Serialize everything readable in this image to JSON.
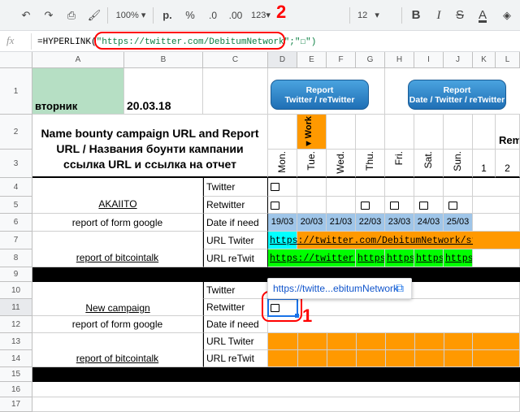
{
  "toolbar": {
    "zoom": "100%",
    "currency": "р.",
    "percent": "%",
    "dec_minus": ".0",
    "dec_plus": ".00",
    "format_more": "123",
    "font_size": "12",
    "bold": "B",
    "italic": "I",
    "strike": "S",
    "text_color": "A",
    "annotation": "2"
  },
  "formula_bar": {
    "fx": "fx",
    "prefix": "=HYPERLINK(",
    "url_arg": "\"https://twitter.com/DebitumNetwork\"",
    "suffix_arg": ";\"☐\")"
  },
  "columns": [
    "A",
    "B",
    "C",
    "D",
    "E",
    "F",
    "G",
    "H",
    "I",
    "J",
    "K",
    "L"
  ],
  "rows": [
    "1",
    "2",
    "3",
    "4",
    "5",
    "6",
    "7",
    "8",
    "9",
    "10",
    "11",
    "12",
    "13",
    "14",
    "15",
    "16",
    "17"
  ],
  "header": {
    "weekday": "вторник",
    "date": "20.03.18",
    "title": "Name bounty campaign URL and Report URL / Названия боунти кампании ссылка URL и ссылка на отчет",
    "btn_report1": "Report\nTwitter / reTwitter",
    "btn_report2": "Report\nDate / Twitter / reTwitter",
    "work": "◄Work",
    "days": [
      "Mon.",
      "Tue.",
      "Wed.",
      "Thu.",
      "Fri.",
      "Sat.",
      "Sun."
    ],
    "nums": [
      "1",
      "2"
    ],
    "rem": "Rem"
  },
  "campaign1": {
    "name": "AKAIITO",
    "report_form": "report of form google",
    "report_talk": "report of bitcointalk",
    "labels": [
      "Twitter",
      "Retwitter",
      "Date if need",
      "URL Twiter",
      "URL reTwit"
    ],
    "dates": [
      "19/03",
      "20/03",
      "21/03",
      "22/03",
      "23/03",
      "24/03",
      "25/03"
    ],
    "url_twiter": "https://twitter.com/DebitumNetwork/statu",
    "url_retwit": [
      "https://twitter.c",
      "https",
      "https",
      "https",
      "https"
    ]
  },
  "campaign2": {
    "name": "New campaign",
    "report_form": "report of form google",
    "report_talk": "report of bitcointalk",
    "labels": [
      "Twitter",
      "Retwitter",
      "Date if need",
      "URL Twiter",
      "URL reTwit"
    ]
  },
  "link_popup": {
    "text": "https://twitte...ebitumNetwork",
    "icon": "open-in-new-icon"
  },
  "annotation_cell": "1",
  "colors": {
    "green_header": "#b6dfc4",
    "orange": "#ff9900",
    "cyan": "#00ffff",
    "green": "#00ff00",
    "date_blue": "#9fc5e8",
    "annotation_red": "#ff0000"
  }
}
